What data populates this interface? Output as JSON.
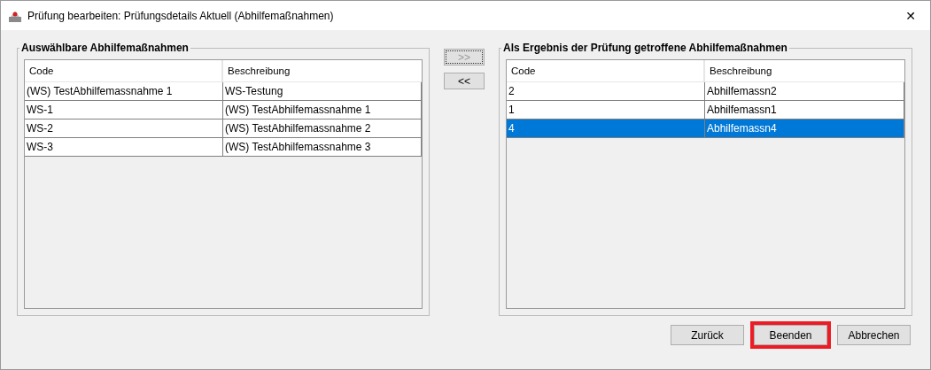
{
  "window": {
    "title": "Prüfung bearbeiten: Prüfungsdetails Aktuell (Abhilfemaßnahmen)",
    "close": "✕"
  },
  "available": {
    "title": "Auswählbare Abhilfemaßnahmen",
    "columns": [
      "Code",
      "Beschreibung"
    ],
    "rows": [
      {
        "cells": [
          "(WS) TestAbhilfemassnahme 1",
          "WS-Testung"
        ],
        "selected": false
      },
      {
        "cells": [
          "WS-1",
          "(WS) TestAbhilfemassnahme 1"
        ],
        "selected": false
      },
      {
        "cells": [
          "WS-2",
          "(WS) TestAbhilfemassnahme 2"
        ],
        "selected": false
      },
      {
        "cells": [
          "WS-3",
          "(WS) TestAbhilfemassnahme 3"
        ],
        "selected": false
      }
    ]
  },
  "move_buttons": [
    {
      "label": ">>",
      "disabled": true
    },
    {
      "label": "<<",
      "disabled": false
    }
  ],
  "chosen": {
    "title": "Als Ergebnis der Prüfung getroffene Abhilfemaßnahmen",
    "columns": [
      "Code",
      "Beschreibung"
    ],
    "rows": [
      {
        "cells": [
          "2",
          "Abhilfemassn2"
        ],
        "selected": false
      },
      {
        "cells": [
          "1",
          "Abhilfemassn1"
        ],
        "selected": false
      },
      {
        "cells": [
          "4",
          "Abhilfemassn4"
        ],
        "selected": true
      }
    ]
  },
  "buttons": [
    {
      "label": "Zurück",
      "highlighted": false
    },
    {
      "label": "Beenden",
      "highlighted": true
    },
    {
      "label": "Abbrechen",
      "highlighted": false
    }
  ]
}
